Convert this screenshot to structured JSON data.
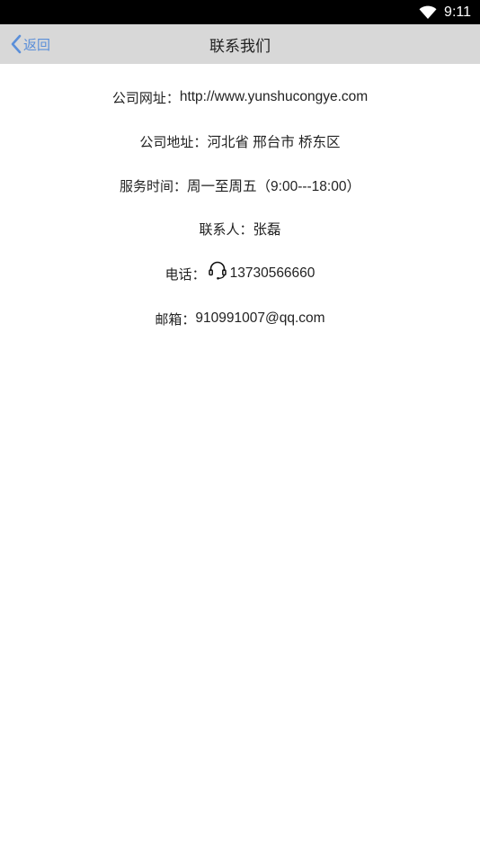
{
  "status_bar": {
    "time": "9:11",
    "wifi_icon": "wifi-icon"
  },
  "nav": {
    "back_label": "返回",
    "title": "联系我们",
    "back_icon": "chevron-left-icon"
  },
  "info": {
    "website": {
      "label": "公司网址：",
      "value": "http://www.yunshucongye.com"
    },
    "address": {
      "label": "公司地址：",
      "value": "河北省 邢台市 桥东区"
    },
    "hours": {
      "label": "服务时间：",
      "value": "周一至周五（9:00---18:00）"
    },
    "contact": {
      "label": "联系人：",
      "value": "张磊"
    },
    "phone": {
      "label": "电话：",
      "value": "13730566660",
      "icon": "headset-icon"
    },
    "email": {
      "label": "邮箱：",
      "value": "910991007@qq.com"
    }
  },
  "colors": {
    "accent": "#5b8fd9",
    "nav_bg": "#d8d8d8",
    "status_bg": "#000000"
  }
}
